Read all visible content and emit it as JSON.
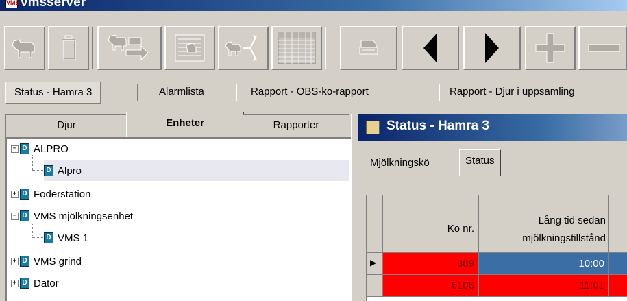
{
  "window": {
    "title": "vmsserver",
    "logo_text": "VMS"
  },
  "toolbar": {
    "buttons": [
      {
        "icon": "cow-icon",
        "enabled": false
      },
      {
        "icon": "trash-icon",
        "enabled": false
      },
      {
        "icon": "cow-move-icon",
        "enabled": false
      },
      {
        "icon": "cow-list-icon",
        "enabled": false
      },
      {
        "icon": "cow-branch-icon",
        "enabled": false
      },
      {
        "icon": "grid-table-icon",
        "enabled": false
      },
      {
        "icon": "printer-icon",
        "enabled": false
      },
      {
        "icon": "arrow-left-icon",
        "enabled": true
      },
      {
        "icon": "arrow-right-icon",
        "enabled": true
      },
      {
        "icon": "plus-icon",
        "enabled": false
      },
      {
        "icon": "minus-icon",
        "enabled": false
      }
    ]
  },
  "window_tabs": [
    {
      "label": "Status - Hamra 3",
      "active": true
    },
    {
      "label": "Alarmlista",
      "active": false
    },
    {
      "label": "Rapport - OBS-ko-rapport",
      "active": false
    },
    {
      "label": "Rapport - Djur i uppsamling",
      "active": false
    }
  ],
  "left_tabs": [
    {
      "label": "Djur",
      "active": false
    },
    {
      "label": "Enheter",
      "active": true
    },
    {
      "label": "Rapporter",
      "active": false
    }
  ],
  "tree": {
    "device_glyph": "D",
    "nodes": [
      {
        "label": "ALPRO",
        "level": 0,
        "expander": "−"
      },
      {
        "label": "Alpro",
        "level": 1,
        "selected": true
      },
      {
        "label": "Foderstation",
        "level": 0,
        "expander": "+"
      },
      {
        "label": "VMS mjölkningsenhet",
        "level": 0,
        "expander": "−"
      },
      {
        "label": "VMS 1",
        "level": 1
      },
      {
        "label": "VMS grind",
        "level": 0,
        "expander": "+"
      },
      {
        "label": "Dator",
        "level": 0,
        "expander": "+"
      }
    ]
  },
  "status_window": {
    "title": "Status - Hamra 3",
    "tabs": [
      {
        "label": "Mjölkningskö",
        "active": false
      },
      {
        "label": "Status",
        "active": true
      }
    ],
    "table": {
      "columns": [
        "",
        "Ko nr.",
        "Lång tid sedan mjölkningstillstånd"
      ],
      "column_lines": [
        [
          "Ko nr."
        ],
        [
          "Lång tid sedan",
          "mjölkningstillstånd"
        ]
      ],
      "rows": [
        {
          "marker": "▶",
          "ko_nr": "389",
          "tid": "10:00"
        },
        {
          "marker": "",
          "ko_nr": "6106",
          "tid": "11:01"
        }
      ]
    },
    "colors": {
      "alarm_red": "#ff0000",
      "time_blue": "#3a6ea5"
    }
  }
}
